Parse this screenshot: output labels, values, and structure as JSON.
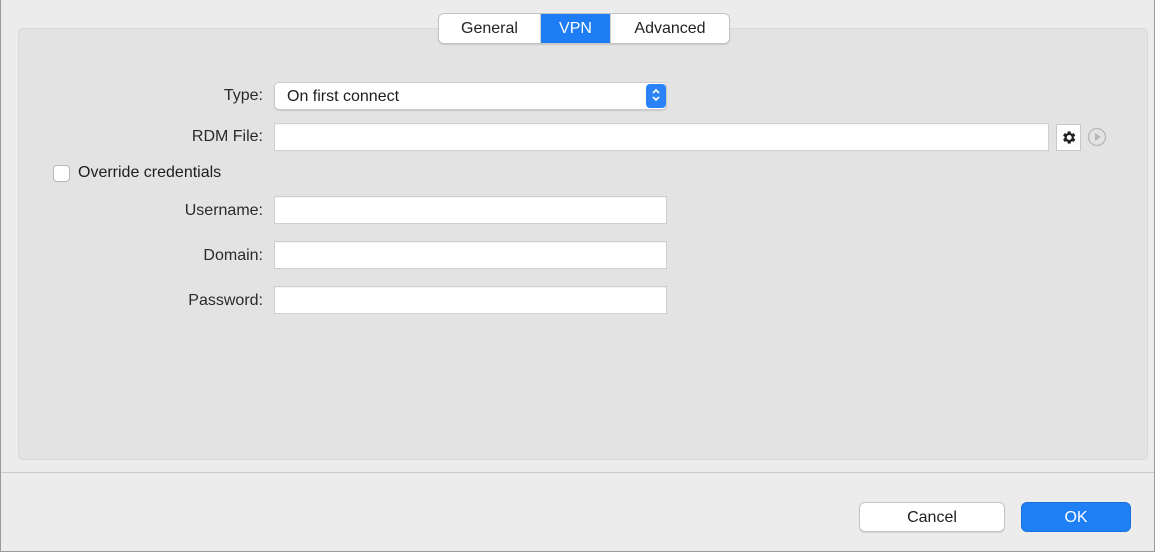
{
  "tabs": {
    "general": "General",
    "vpn": "VPN",
    "advanced": "Advanced",
    "active": "VPN"
  },
  "form": {
    "type_label": "Type:",
    "type_value": "On first connect",
    "rdm_label": "RDM File:",
    "rdm_value": "",
    "override_label": "Override credentials",
    "override_checked": false,
    "username_label": "Username:",
    "username_value": "",
    "domain_label": "Domain:",
    "domain_value": "",
    "password_label": "Password:",
    "password_value": ""
  },
  "icons": {
    "select_arrow": "up-down-chevron-icon",
    "gear": "gear-icon",
    "play": "play-circle-icon"
  },
  "buttons": {
    "cancel": "Cancel",
    "ok": "OK"
  },
  "colors": {
    "accent": "#1e7df5",
    "panel": "#e3e3e3",
    "window": "#ececec"
  }
}
